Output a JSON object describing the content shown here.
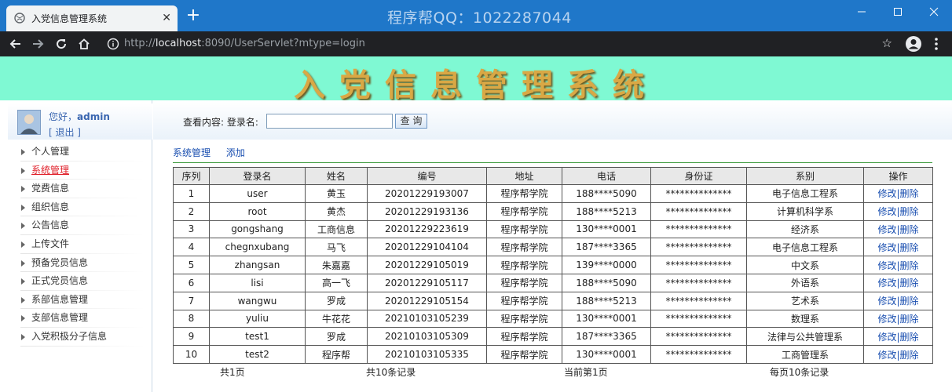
{
  "browser": {
    "tab_title": "入党信息管理系统",
    "tab_close": "✕",
    "new_tab": "+",
    "watermark": "程序帮QQ：1022287044",
    "url_scheme": "http://",
    "url_host": "localhost",
    "url_rest": ":8090/UserServlet?mtype=login",
    "icons": {
      "back": "back-arrow-icon",
      "forward": "forward-arrow-icon",
      "reload": "reload-icon",
      "home": "home-icon",
      "info": "info-icon",
      "star": "star-icon",
      "profile": "profile-icon",
      "menu": "menu-dots-icon",
      "minimize": "minimize-icon",
      "maximize": "maximize-icon",
      "close": "close-icon"
    },
    "colors": {
      "titlebar": "#1f77c9",
      "toolbar": "#202124"
    }
  },
  "header": {
    "title": "入党信息管理系统",
    "background": "#7ff9d3"
  },
  "sidebar": {
    "greeting": "您好，",
    "username": "admin",
    "logout": "[ 退出 ]",
    "items": [
      {
        "label": "个人管理",
        "active": false
      },
      {
        "label": "系统管理",
        "active": true
      },
      {
        "label": "党费信息",
        "active": false
      },
      {
        "label": "组织信息",
        "active": false
      },
      {
        "label": "公告信息",
        "active": false
      },
      {
        "label": "上传文件",
        "active": false
      },
      {
        "label": "预备党员信息",
        "active": false
      },
      {
        "label": "正式党员信息",
        "active": false
      },
      {
        "label": "系部信息管理",
        "active": false
      },
      {
        "label": "支部信息管理",
        "active": false
      },
      {
        "label": "入党积极分子信息",
        "active": false
      }
    ]
  },
  "search": {
    "label": "查看内容:  登录名:",
    "value": "",
    "button": "查 询"
  },
  "subnav": {
    "system": "系统管理",
    "add": "添加"
  },
  "table": {
    "columns": [
      "序列",
      "登录名",
      "姓名",
      "编号",
      "地址",
      "电话",
      "身份证",
      "系别",
      "操作"
    ],
    "rows": [
      [
        "1",
        "user",
        "黄玉",
        "20201229193007",
        "程序帮学院",
        "188****5090",
        "**************",
        "电子信息工程系"
      ],
      [
        "2",
        "root",
        "黄杰",
        "20201229193136",
        "程序帮学院",
        "188****5213",
        "**************",
        "计算机科学系"
      ],
      [
        "3",
        "gongshang",
        "工商信息",
        "20201229223619",
        "程序帮学院",
        "130****0001",
        "**************",
        "经济系"
      ],
      [
        "4",
        "chegnxubang",
        "马飞",
        "20201229104104",
        "程序帮学院",
        "187****3365",
        "**************",
        "电子信息工程系"
      ],
      [
        "5",
        "zhangsan",
        "朱嘉嘉",
        "20201229105019",
        "程序帮学院",
        "139****0000",
        "**************",
        "中文系"
      ],
      [
        "6",
        "lisi",
        "高一飞",
        "20201229105117",
        "程序帮学院",
        "188****5090",
        "**************",
        "外语系"
      ],
      [
        "7",
        "wangwu",
        "罗成",
        "20201229105154",
        "程序帮学院",
        "188****5213",
        "**************",
        "艺术系"
      ],
      [
        "8",
        "yuliu",
        "牛花花",
        "20210103105239",
        "程序帮学院",
        "130****0001",
        "**************",
        "数理系"
      ],
      [
        "9",
        "test1",
        "罗成",
        "20210103105309",
        "程序帮学院",
        "187****3365",
        "**************",
        "法律与公共管理系"
      ],
      [
        "10",
        "test2",
        "程序帮",
        "20210103105335",
        "程序帮学院",
        "130****0001",
        "**************",
        "工商管理系"
      ]
    ],
    "op_edit": "修改",
    "op_sep": "|",
    "op_delete": "删除"
  },
  "pager": {
    "pages": "共1页",
    "records": "共10条记录",
    "current": "当前第1页",
    "per_page": "每页10条记录"
  }
}
